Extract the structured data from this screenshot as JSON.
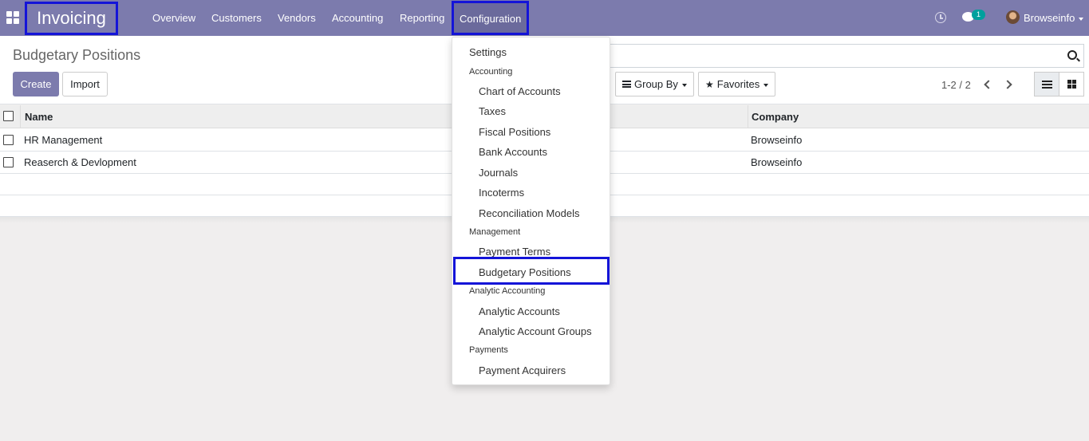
{
  "navbar": {
    "app_title": "Invoicing",
    "menus": [
      "Overview",
      "Customers",
      "Vendors",
      "Accounting",
      "Reporting",
      "Configuration"
    ],
    "messages_badge": "1",
    "user_name": "Browseinfo"
  },
  "control_panel": {
    "page_title": "Budgetary Positions",
    "create_label": "Create",
    "import_label": "Import",
    "groupby_label": "Group By",
    "favorites_label": "Favorites",
    "pager": "1-2 / 2"
  },
  "list": {
    "columns": [
      "Name",
      "Company"
    ],
    "rows": [
      {
        "name": "HR Management",
        "company": "Browseinfo"
      },
      {
        "name": "Reaserch & Devlopment",
        "company": "Browseinfo"
      }
    ]
  },
  "config_menu": {
    "settings": "Settings",
    "sections": [
      {
        "header": "Accounting",
        "items": [
          "Chart of Accounts",
          "Taxes",
          "Fiscal Positions",
          "Bank Accounts",
          "Journals",
          "Incoterms",
          "Reconciliation Models"
        ]
      },
      {
        "header": "Management",
        "items": [
          "Payment Terms",
          "Budgetary Positions"
        ]
      },
      {
        "header": "Analytic Accounting",
        "items": [
          "Analytic Accounts",
          "Analytic Account Groups"
        ]
      },
      {
        "header": "Payments",
        "items": [
          "Payment Acquirers"
        ]
      }
    ]
  },
  "colors": {
    "navbar": "#7c7bad",
    "highlight_border": "#1414d8",
    "badge": "#00a09d"
  }
}
